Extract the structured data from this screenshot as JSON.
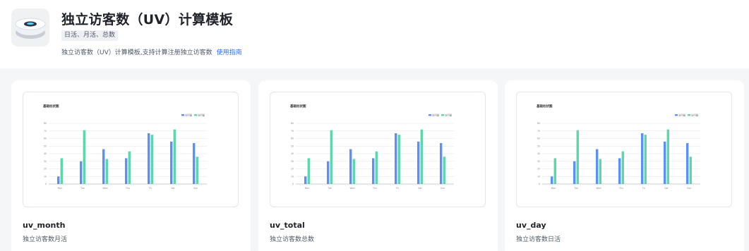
{
  "template": {
    "title": "独立访客数（UV）计算模板",
    "tags": [
      "日活、月活、总数"
    ],
    "description": "独立访客数（UV）计算模板,支持计算注册独立访客数",
    "guide_link": "使用指南"
  },
  "cards": [
    {
      "name": "uv_month",
      "subtitle": "独立访客数月活"
    },
    {
      "name": "uv_total",
      "subtitle": "独立访客数总数"
    },
    {
      "name": "uv_day",
      "subtitle": "独立访客数日活"
    }
  ],
  "chart_data": {
    "type": "bar",
    "title": "基础柱状图",
    "categories": [
      "Mon",
      "Tue",
      "Wed",
      "Thu",
      "Fri",
      "Sat",
      "Sun"
    ],
    "series": [
      {
        "name": "访问量",
        "values": [
          10,
          30,
          46,
          34,
          67,
          56,
          54
        ],
        "color": "#5b8ff9"
      },
      {
        "name": "访问量",
        "values": [
          34,
          71,
          33,
          43,
          65,
          72,
          36
        ],
        "color": "#5ad8a6"
      }
    ],
    "yticks": [
      0,
      10,
      20,
      30,
      40,
      50,
      60,
      70,
      80
    ],
    "ylim": [
      0,
      80
    ],
    "grid": true,
    "legend": "top-right"
  },
  "colors": {
    "accent": "#2f6ff0",
    "page_bg": "#f5f6f8"
  }
}
